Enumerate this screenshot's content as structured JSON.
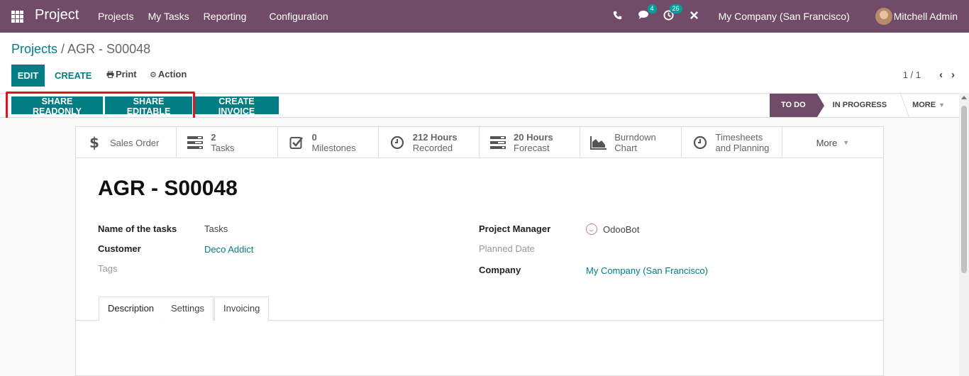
{
  "navbar": {
    "app_name": "Project",
    "menu": [
      "Projects",
      "My Tasks",
      "Reporting",
      "Configuration"
    ],
    "messages_count": "4",
    "activities_count": "26",
    "company": "My Company (San Francisco)",
    "user": "Mitchell Admin"
  },
  "breadcrumb": {
    "parent": "Projects",
    "separator": " / ",
    "current": "AGR - S00048"
  },
  "controls": {
    "edit": "EDIT",
    "create": "CREATE",
    "print": "Print",
    "action": "Action",
    "pager": "1 / 1"
  },
  "statusbar": {
    "share_readonly": "SHARE READONLY",
    "share_editable": "SHARE EDITABLE",
    "create_invoice": "CREATE INVOICE",
    "stages": [
      "TO DO",
      "IN PROGRESS",
      "MORE"
    ],
    "active_stage": "TO DO"
  },
  "smart_buttons": [
    {
      "value": "",
      "label": "Sales Order",
      "icon": "dollar-icon"
    },
    {
      "value": "2",
      "label": "Tasks",
      "icon": "tasks-icon"
    },
    {
      "value": "0",
      "label": "Milestones",
      "icon": "check-square-icon"
    },
    {
      "value": "212 Hours",
      "label": "Recorded",
      "icon": "clock-icon"
    },
    {
      "value": "20 Hours",
      "label": "Forecast",
      "icon": "tasks-icon"
    },
    {
      "value": "Burndown",
      "label": "Chart",
      "icon": "area-chart-icon"
    },
    {
      "value": "Timesheets",
      "label": "and Planning",
      "icon": "clock-icon"
    },
    {
      "value": "",
      "label": "More",
      "icon": "caret-down-icon"
    }
  ],
  "record": {
    "title": "AGR - S00048",
    "fields_left": [
      {
        "label": "Name of the tasks",
        "value": "Tasks"
      },
      {
        "label": "Customer",
        "value": "Deco Addict"
      },
      {
        "label": "Tags",
        "value": ""
      }
    ],
    "fields_right": [
      {
        "label": "Project Manager",
        "value": "OdooBot"
      },
      {
        "label": "Planned Date",
        "value": ""
      },
      {
        "label": "Company",
        "value": "My Company (San Francisco)"
      }
    ]
  },
  "tabs": [
    "Description",
    "Settings",
    "Invoicing"
  ],
  "active_tab": "Description",
  "colors": {
    "brand": "#714b67",
    "accent": "#017e84",
    "highlight_box": "#e0141e"
  }
}
